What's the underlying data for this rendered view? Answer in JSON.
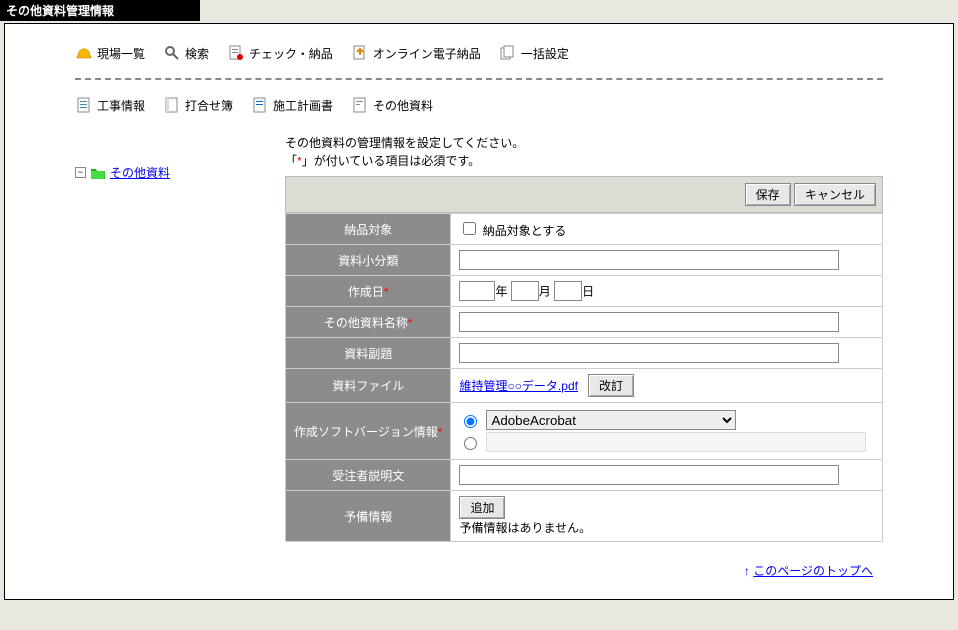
{
  "title": "その他資料管理情報",
  "toolbar1": {
    "site_list": "現場一覧",
    "search": "検索",
    "check_deliver": "チェック・納品",
    "online_deliver": "オンライン電子納品",
    "batch_settings": "一括設定"
  },
  "toolbar2": {
    "construction_info": "工事情報",
    "meeting_log": "打合せ簿",
    "construction_plan": "施工計画書",
    "other_materials": "その他資料"
  },
  "tree": {
    "root_label": "その他資料"
  },
  "instructions": {
    "line1": "その他資料の管理情報を設定してください。",
    "line2_pre": "「",
    "line2_mark": "*",
    "line2_post": "」が付いている項目は必須です。"
  },
  "actions": {
    "save": "保存",
    "cancel": "キャンセル"
  },
  "form": {
    "delivery_target_label": "納品対象",
    "delivery_target_checkbox": "納品対象とする",
    "subcategory_label": "資料小分類",
    "creation_date_label": "作成日",
    "year_suffix": "年",
    "month_suffix": "月",
    "day_suffix": "日",
    "other_material_name_label": "その他資料名称",
    "subtitle_label": "資料副題",
    "file_label": "資料ファイル",
    "file_link": "維持管理○○データ.pdf",
    "revise_btn": "改訂",
    "software_version_label": "作成ソフトバージョン情報",
    "software_option": "AdobeAcrobat",
    "contractor_note_label": "受注者説明文",
    "reserve_label": "予備情報",
    "add_btn": "追加",
    "reserve_empty": "予備情報はありません。"
  },
  "page_top": "このページのトップへ",
  "page_top_arrow": "↑"
}
